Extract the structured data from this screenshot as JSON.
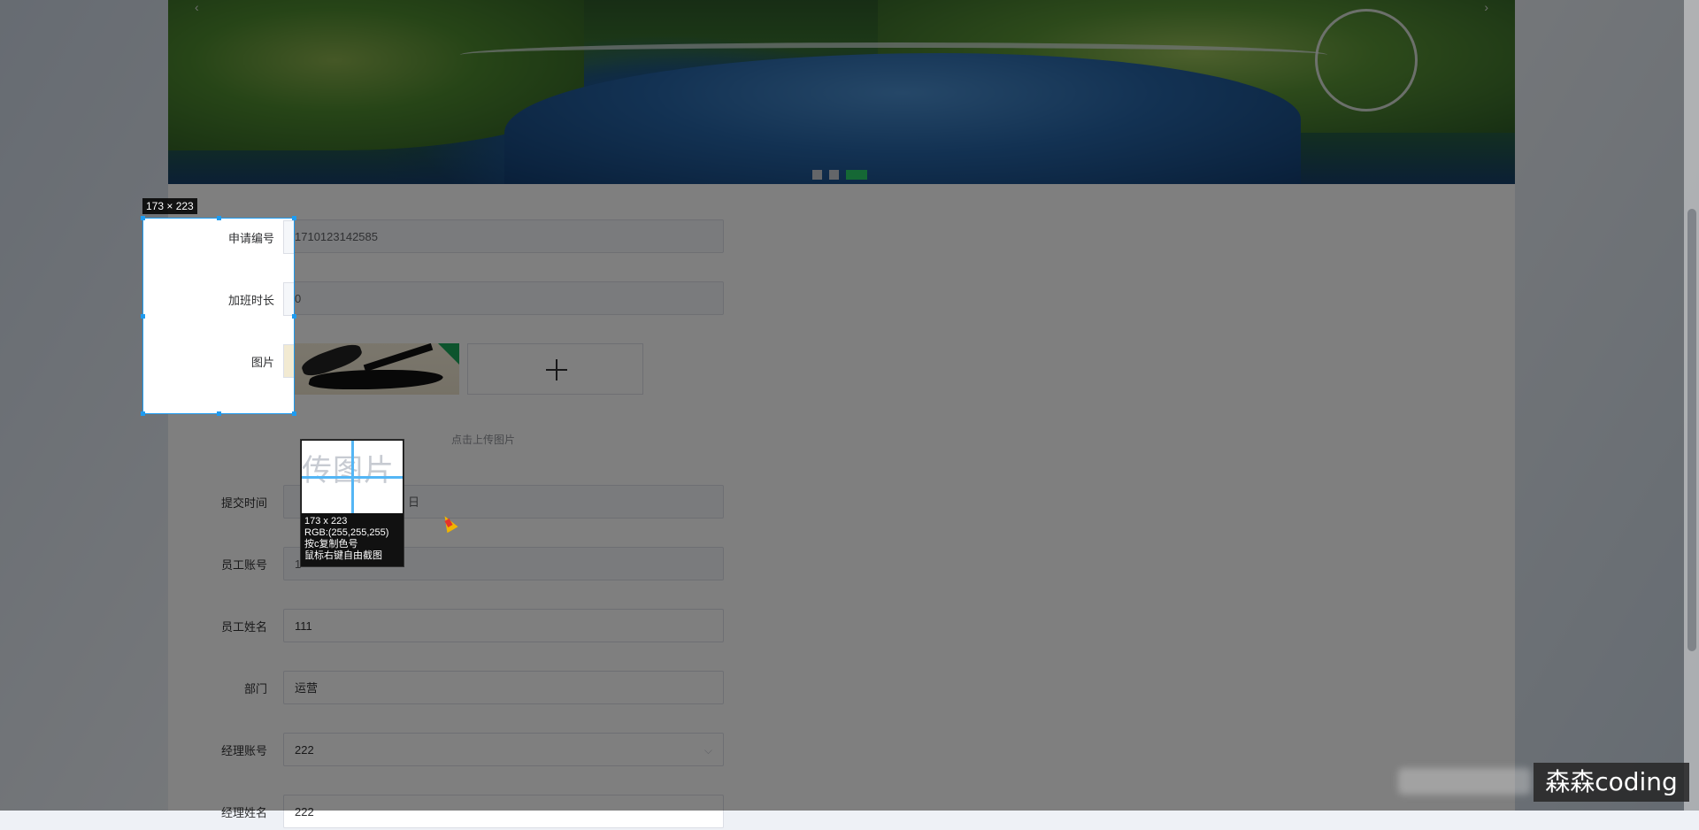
{
  "form": {
    "rows": [
      {
        "label": "申请编号",
        "value": "1710123142585",
        "disabled": true
      },
      {
        "label": "加班时长",
        "value": "0",
        "disabled": true
      },
      {
        "label": "图片",
        "value": ""
      },
      {
        "label": "提交时间",
        "value": "日",
        "disabled": true
      },
      {
        "label": "员工账号",
        "value": "1",
        "disabled": true
      },
      {
        "label": "员工姓名",
        "value": "111",
        "disabled": false
      },
      {
        "label": "部门",
        "value": "运营",
        "disabled": false
      },
      {
        "label": "经理账号",
        "value": "222",
        "disabled": false
      },
      {
        "label": "经理姓名",
        "value": "222",
        "disabled": false
      }
    ],
    "upload_hint": "点击上传图片"
  },
  "screenshot_tool": {
    "size_tag": "173 × 223",
    "magnifier_text": "传图片",
    "info": {
      "size": "173 x 223",
      "rgb": "RGB:(255,255,255)",
      "copy_hint": "按c复制色号",
      "free_hint": "鼠标右键自由截图"
    }
  },
  "banner": {
    "prev": "‹",
    "next": "›",
    "dots": 3,
    "active_dot": 2
  },
  "watermark": "森森coding",
  "colors": {
    "selection": "#1e9bf0",
    "active_dot": "#2ad16a",
    "overlay": "rgba(0,0,0,0.50)"
  }
}
